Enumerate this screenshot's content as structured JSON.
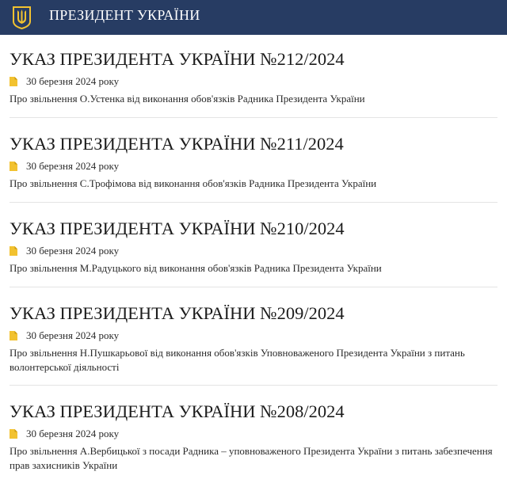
{
  "header": {
    "title": "ПРЕЗИДЕНТ УКРАЇНИ",
    "logo_icon": "trident-coat-of-arms-icon",
    "background": "#273c63",
    "logo_color": "#f2c230"
  },
  "accent_color": "#f2c230",
  "items": [
    {
      "title": "УКАЗ ПРЕЗИДЕНТА УКРАЇНИ №212/2024",
      "date": "30 березня 2024 року",
      "description": "Про звільнення О.Устенка від виконання обов'язків Радника Президента України"
    },
    {
      "title": "УКАЗ ПРЕЗИДЕНТА УКРАЇНИ №211/2024",
      "date": "30 березня 2024 року",
      "description": "Про звільнення С.Трофімова від виконання обов'язків Радника Президента України"
    },
    {
      "title": "УКАЗ ПРЕЗИДЕНТА УКРАЇНИ №210/2024",
      "date": "30 березня 2024 року",
      "description": "Про звільнення М.Радуцького від виконання обов'язків Радника Президента України"
    },
    {
      "title": "УКАЗ ПРЕЗИДЕНТА УКРАЇНИ №209/2024",
      "date": "30 березня 2024 року",
      "description": "Про звільнення Н.Пушкарьової від виконання обов'язків Уповноваженого Президента України з питань волонтерської діяльності"
    },
    {
      "title": "УКАЗ ПРЕЗИДЕНТА УКРАЇНИ №208/2024",
      "date": "30 березня 2024 року",
      "description": "Про звільнення А.Вербицької з посади Радника – уповноваженого Президента України з питань забезпечення прав захисників України"
    }
  ]
}
